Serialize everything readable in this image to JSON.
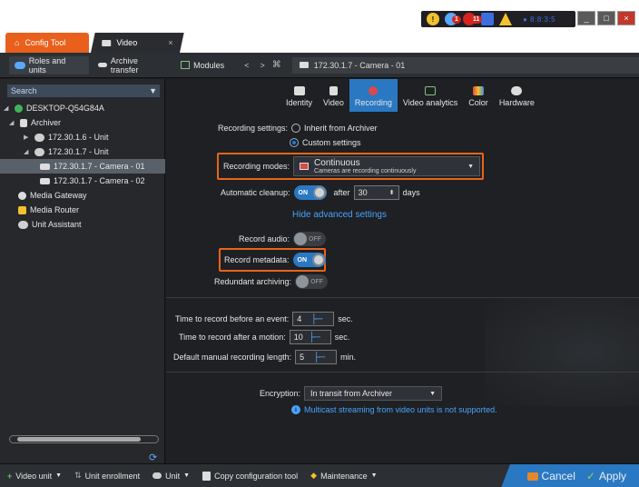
{
  "tray": {
    "badge_1": "1",
    "badge_2": "11",
    "time_text": "● 8:8:3:5"
  },
  "tabs": {
    "config_tool": "Config Tool",
    "video": "Video",
    "close": "×"
  },
  "toolbar": {
    "roles_and_units": "Roles and units",
    "archive_transfer": "Archive transfer",
    "modules": "Modules",
    "back": "<",
    "forward": ">",
    "address": "172.30.1.7 - Camera - 01"
  },
  "leftpane": {
    "search_placeholder": "Search",
    "tree": [
      {
        "label": "DESKTOP-Q54G84A"
      },
      {
        "label": "Archiver"
      },
      {
        "label": "172.30.1.6 - Unit"
      },
      {
        "label": "172.30.1.7 - Unit"
      },
      {
        "label": "172.30.1.7 - Camera - 01"
      },
      {
        "label": "172.30.1.7 - Camera - 02"
      },
      {
        "label": "Media Gateway"
      },
      {
        "label": "Media Router"
      },
      {
        "label": "Unit Assistant"
      }
    ]
  },
  "configtabs": [
    {
      "label": "Identity"
    },
    {
      "label": "Video"
    },
    {
      "label": "Recording"
    },
    {
      "label": "Video analytics"
    },
    {
      "label": "Color"
    },
    {
      "label": "Hardware"
    }
  ],
  "recording": {
    "settings_label": "Recording settings:",
    "inherit": "Inherit from Archiver",
    "custom": "Custom settings",
    "modes_label": "Recording modes:",
    "mode_value": "Continuous",
    "mode_desc": "Cameras are recording continuously",
    "cleanup_label": "Automatic cleanup:",
    "on": "ON",
    "off": "OFF",
    "after": "after",
    "cleanup_days": "30",
    "days": "days",
    "hide_advanced": "Hide advanced settings",
    "record_audio_label": "Record audio:",
    "record_metadata_label": "Record metadata:",
    "redundant_label": "Redundant archiving:",
    "before_event_label": "Time to record before an event:",
    "before_event_value": "4",
    "after_motion_label": "Time to record after a motion:",
    "after_motion_value": "10",
    "sec": "sec.",
    "manual_length_label": "Default manual recording length:",
    "manual_length_value": "5",
    "min": "min.",
    "encryption_label": "Encryption:",
    "encryption_value": "In transit from Archiver",
    "multicast_note": "Multicast streaming from video units is not supported."
  },
  "bottombar": {
    "video_unit": "Video unit",
    "unit_enrollment": "Unit enrollment",
    "unit": "Unit",
    "copy_config": "Copy configuration tool",
    "maintenance": "Maintenance",
    "cancel": "Cancel",
    "apply": "Apply"
  },
  "colors": {
    "accent": "#2b78c2",
    "highlight": "#e8641c",
    "config_tab": "#e8601c"
  }
}
